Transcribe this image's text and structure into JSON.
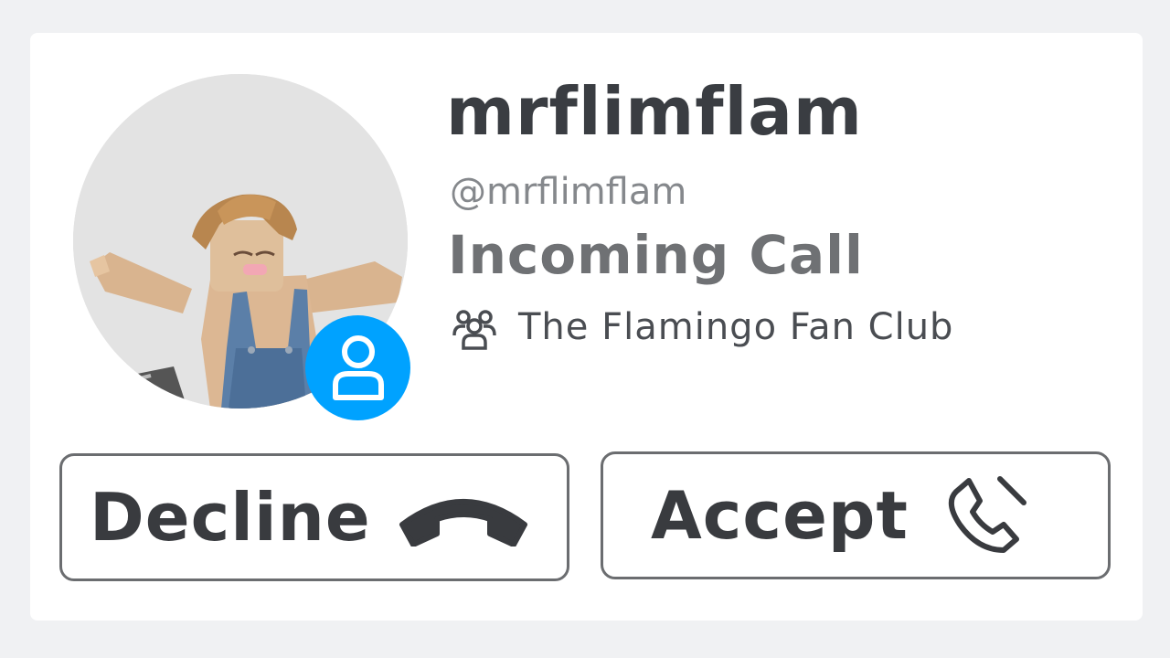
{
  "caller": {
    "display_name": "mrflimflam",
    "username": "@mrflimflam",
    "avatar_icon": "roblox-avatar-farmer",
    "presence_icon": "user-presence-icon",
    "presence_color": "#00a2ff"
  },
  "call": {
    "status": "Incoming Call"
  },
  "group": {
    "icon": "group-icon",
    "name": "The Flamingo Fan Club"
  },
  "actions": {
    "decline_label": "Decline",
    "decline_icon": "phone-hangup-icon",
    "accept_label": "Accept",
    "accept_icon": "phone-icon"
  },
  "colors": {
    "background": "#f0f1f3",
    "card": "#ffffff",
    "text_primary": "#3a3d42",
    "text_secondary": "#85888c",
    "button_border": "#6b6d70"
  }
}
